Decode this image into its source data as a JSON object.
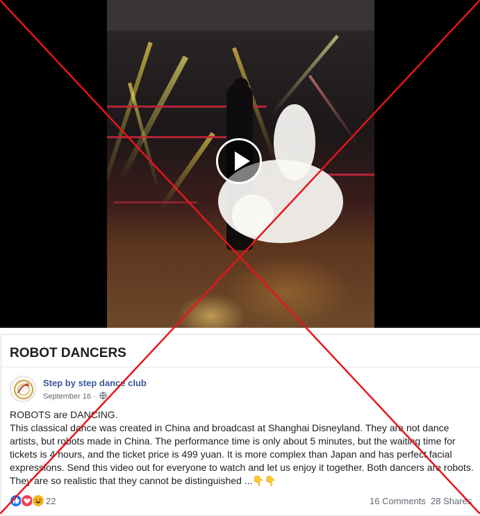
{
  "video": {
    "play_icon": "play-icon"
  },
  "post": {
    "title": "ROBOT DANCERS",
    "page_name": "Step by step dance club",
    "date": "September 16",
    "separator": "·",
    "privacy_icon": "globe-icon",
    "body_lines": [
      "ROBOTS are DANCING.",
      "This classical dance was created in China and broadcast at Shanghai Disneyland. They are not dance artists, but robots made in China. The performance time is only about 5 minutes, but the waiting time for tickets is 4 hours, and the ticket price is 499 yuan. It is more complex than Japan and has perfect facial expressions. Send this video out for everyone to watch and let us enjoy it together. Both dancers are robots. They are so realistic that they cannot be distinguished ...👇👇"
    ],
    "reactions": {
      "icons": [
        "like-icon",
        "love-icon",
        "haha-icon"
      ],
      "count": "22"
    },
    "comments": "16 Comments",
    "shares": "28 Shares"
  },
  "overlay": {
    "type": "red-x-cross",
    "color": "#e8141c"
  }
}
